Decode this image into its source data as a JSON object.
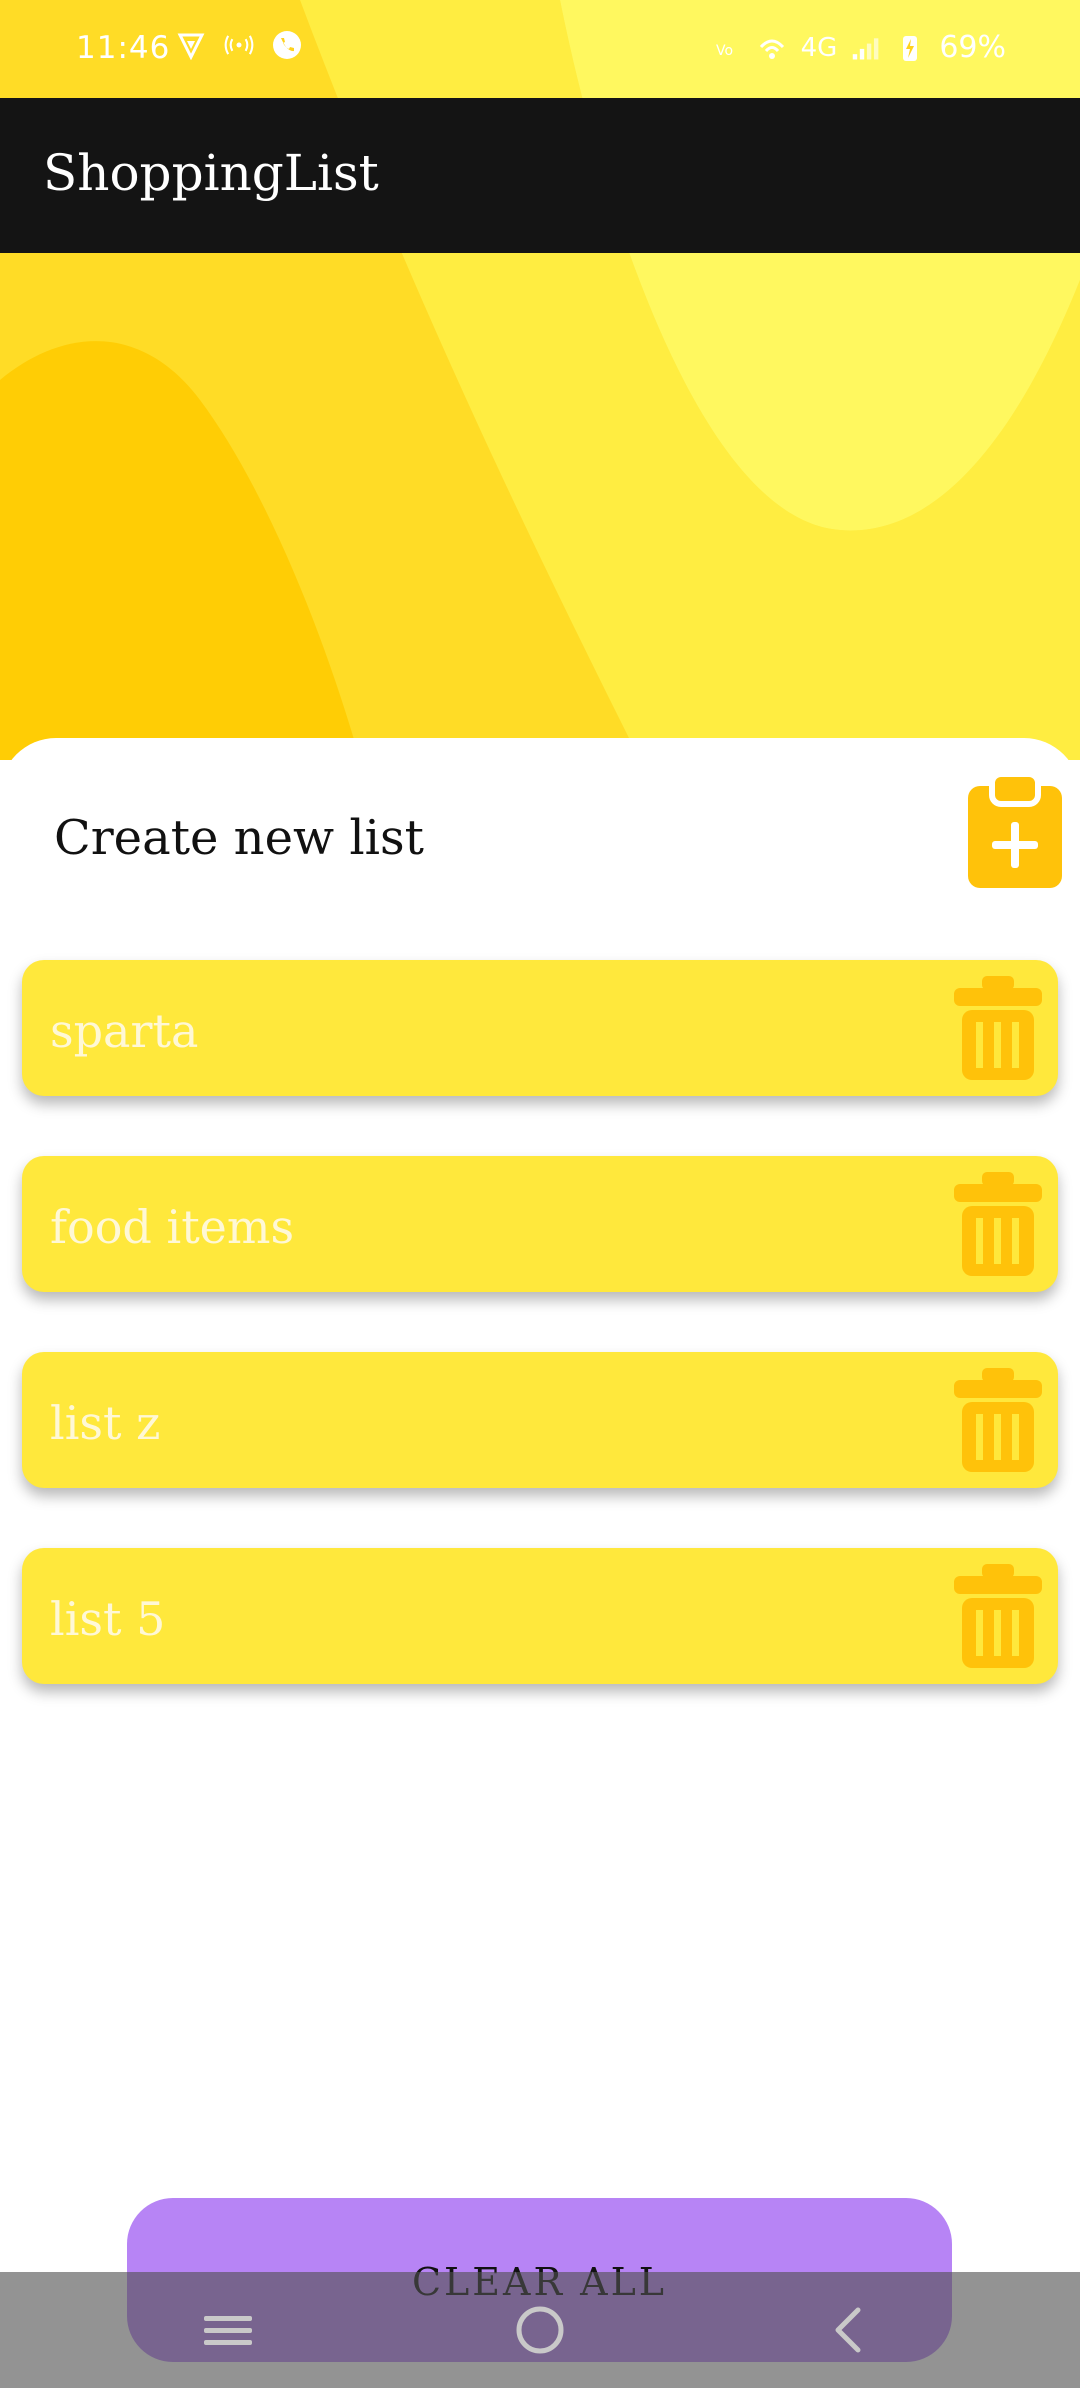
{
  "status_bar": {
    "time": "11:46",
    "battery_text": "69%",
    "network_text": "4G",
    "left_icons": [
      "vpn-shield-icon",
      "hotspot-icon",
      "call-icon"
    ],
    "right_icons": [
      "volte-icon",
      "wifi-calling-icon",
      "signal-icon",
      "charging-icon"
    ]
  },
  "app_bar": {
    "title": "ShoppingList"
  },
  "sheet": {
    "create_label": "Create new list",
    "create_icon": "clipboard-add-icon",
    "lists": [
      {
        "name": "sparta"
      },
      {
        "name": "food items"
      },
      {
        "name": "list z"
      },
      {
        "name": "list 5"
      }
    ],
    "delete_icon": "trash-icon"
  },
  "clear_all": {
    "label": "CLEAR ALL"
  },
  "nav_bar": {
    "buttons": [
      "recent-apps-icon",
      "home-icon",
      "back-icon"
    ]
  },
  "colors": {
    "accent_yellow": "#ffe83c",
    "icon_orange": "#ffc20a",
    "clear_button": "#b784f5",
    "app_bar": "#141414"
  }
}
